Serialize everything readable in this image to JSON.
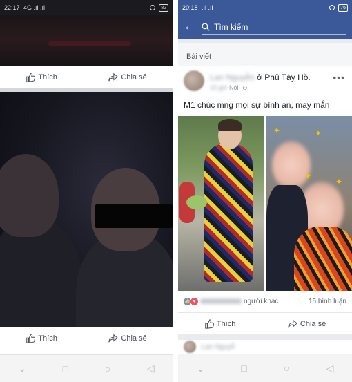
{
  "left": {
    "status": {
      "time": "22:17",
      "signal": "4G .ıl .ıl",
      "battery": "82"
    },
    "actions_top": {
      "like": "Thích",
      "share": "Chia sẻ"
    },
    "actions_bottom": {
      "like": "Thích",
      "share": "Chia sẻ"
    }
  },
  "right": {
    "status": {
      "time": "20:18",
      "signal": ".ıl .ıl",
      "battery": "76"
    },
    "search": {
      "placeholder": "Tìm kiếm"
    },
    "section_label": "Bài viết",
    "post": {
      "author_blurred": "Lan Nguyễn",
      "location": "ở Phủ Tây Hồ.",
      "time_blurred": "15 giờ",
      "place_sub": "Nội",
      "text": "M1 chúc mng mọi sự bình an, may mắn",
      "reactions_suffix": "người khác",
      "comments": "15 bình luận",
      "like": "Thích",
      "share": "Chia sẻ"
    },
    "next_post": {
      "author_partial": "Lan Nguyễ"
    }
  },
  "icons": {
    "like": "thumbs-up-icon",
    "share": "share-arrow-icon",
    "back": "back-arrow-icon",
    "search": "search-icon",
    "nav_back": "triangle-back-icon",
    "nav_home": "circle-home-icon",
    "nav_recent": "square-recent-icon",
    "nav_down": "chevron-down-icon"
  },
  "colors": {
    "facebook_blue": "#3b5998",
    "like_blue": "#5890ff",
    "love_red": "#f25268"
  }
}
